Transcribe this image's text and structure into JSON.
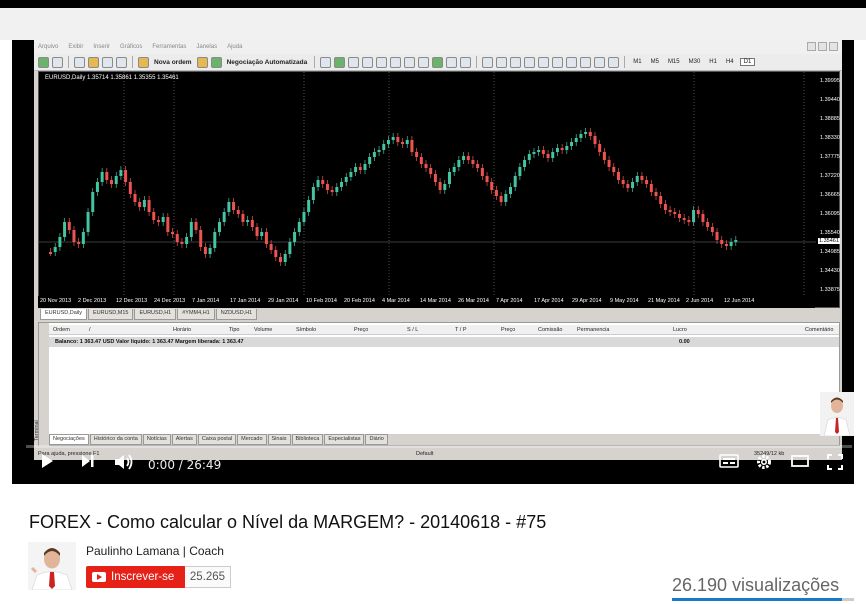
{
  "mt4": {
    "menu": [
      "Arquivo",
      "Exibir",
      "Inserir",
      "Gráficos",
      "Ferramentas",
      "Janelas",
      "Ajuda"
    ],
    "toolbar": {
      "new_order": "Nova ordem",
      "auto_trading": "Negociação Automatizada",
      "timeframes": [
        "M1",
        "M5",
        "M15",
        "M30",
        "H1",
        "H4",
        "D1"
      ],
      "active_timeframe": "D1"
    },
    "chart": {
      "header": "EURUSD,Daily  1.35714 1.35861 1.35355 1.35461",
      "price_labels": [
        "1.39995",
        "1.39440",
        "1.38885",
        "1.38330",
        "1.37775",
        "1.37220",
        "1.36665",
        "1.36095",
        "1.35540",
        "1.34985",
        "1.34430",
        "1.33875"
      ],
      "current_price": "1.35461",
      "date_labels": [
        "20 Nov 2013",
        "2 Dec 2013",
        "12 Dec 2013",
        "24 Dec 2013",
        "7 Jan 2014",
        "17 Jan 2014",
        "29 Jan 2014",
        "10 Feb 2014",
        "20 Feb 2014",
        "4 Mar 2014",
        "14 Mar 2014",
        "26 Mar 2014",
        "7 Apr 2014",
        "17 Apr 2014",
        "29 Apr 2014",
        "9 May 2014",
        "21 May 2014",
        "2 Jun 2014",
        "12 Jun 2014"
      ],
      "colors": {
        "bull": "#44c4a1",
        "bear": "#ef5350",
        "background": "#000000",
        "grid": "#888888"
      }
    },
    "symbol_tabs": [
      "EURUSD,Daily",
      "EURUSD,M15",
      "EURUSD,H1",
      "#YMM4,H1",
      "NZDUSD,H1"
    ],
    "active_symbol_tab": "EURUSD,Daily",
    "terminal": {
      "side_label": "Terminal",
      "columns": [
        "Ordem",
        "/",
        "Horário",
        "Tipo",
        "Volume",
        "Símbolo",
        "Preço",
        "S / L",
        "T / P",
        "Preço",
        "Comissão",
        "Permanencia",
        "Lucro",
        "Comentário"
      ],
      "balance_row": "Balanco: 1 363.47 USD  Valor liquido: 1 363.47  Margem liberada: 1 363.47",
      "balance_profit": "0.00",
      "tabs": [
        "Negociações",
        "Histórico da conta",
        "Notícias",
        "Alertas",
        "Caixa postal",
        "Mercado",
        "Sinais",
        "Biblioteca",
        "Especialistas",
        "Diário"
      ],
      "active_tab": "Negociações"
    },
    "status": {
      "help": "Para ajuda, pressione F1",
      "profile": "Default",
      "traffic": "35249/12 kb"
    }
  },
  "player": {
    "time": "0:00 / 26:49",
    "progress_fraction": 0.0
  },
  "video": {
    "title": "FOREX - Como calcular o Nível da MARGEM? - 20140618 - #75",
    "channel": "Paulinho Lamana | Coach",
    "subscribe_label": "Inscrever-se",
    "subscriber_count": "25.265",
    "views": "26.190 visualizações"
  }
}
